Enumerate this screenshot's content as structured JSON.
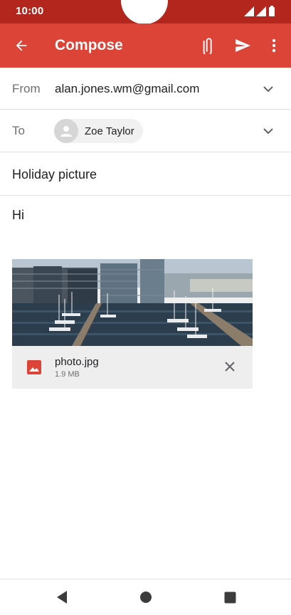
{
  "status_bar": {
    "time": "10:00",
    "icons": [
      "wifi-icon",
      "signal-icon",
      "battery-icon"
    ]
  },
  "app_bar": {
    "title": "Compose",
    "back_icon": "arrow-back-icon",
    "attach_icon": "paperclip-icon",
    "send_icon": "send-icon",
    "more_icon": "more-vert-icon",
    "background_color": "#db4437"
  },
  "from": {
    "label": "From",
    "value": "alan.jones.wm@gmail.com"
  },
  "to": {
    "label": "To",
    "recipient_name": "Zoe Taylor"
  },
  "subject": {
    "value": "Holiday picture"
  },
  "body": {
    "text": "Hi"
  },
  "attachment": {
    "file_name": "photo.jpg",
    "file_size": "1.9 MB",
    "type_icon": "image-icon",
    "remove_icon": "close-icon"
  },
  "nav_bar": {
    "back_icon": "nav-back-icon",
    "home_icon": "nav-home-icon",
    "recents_icon": "nav-recents-icon"
  }
}
